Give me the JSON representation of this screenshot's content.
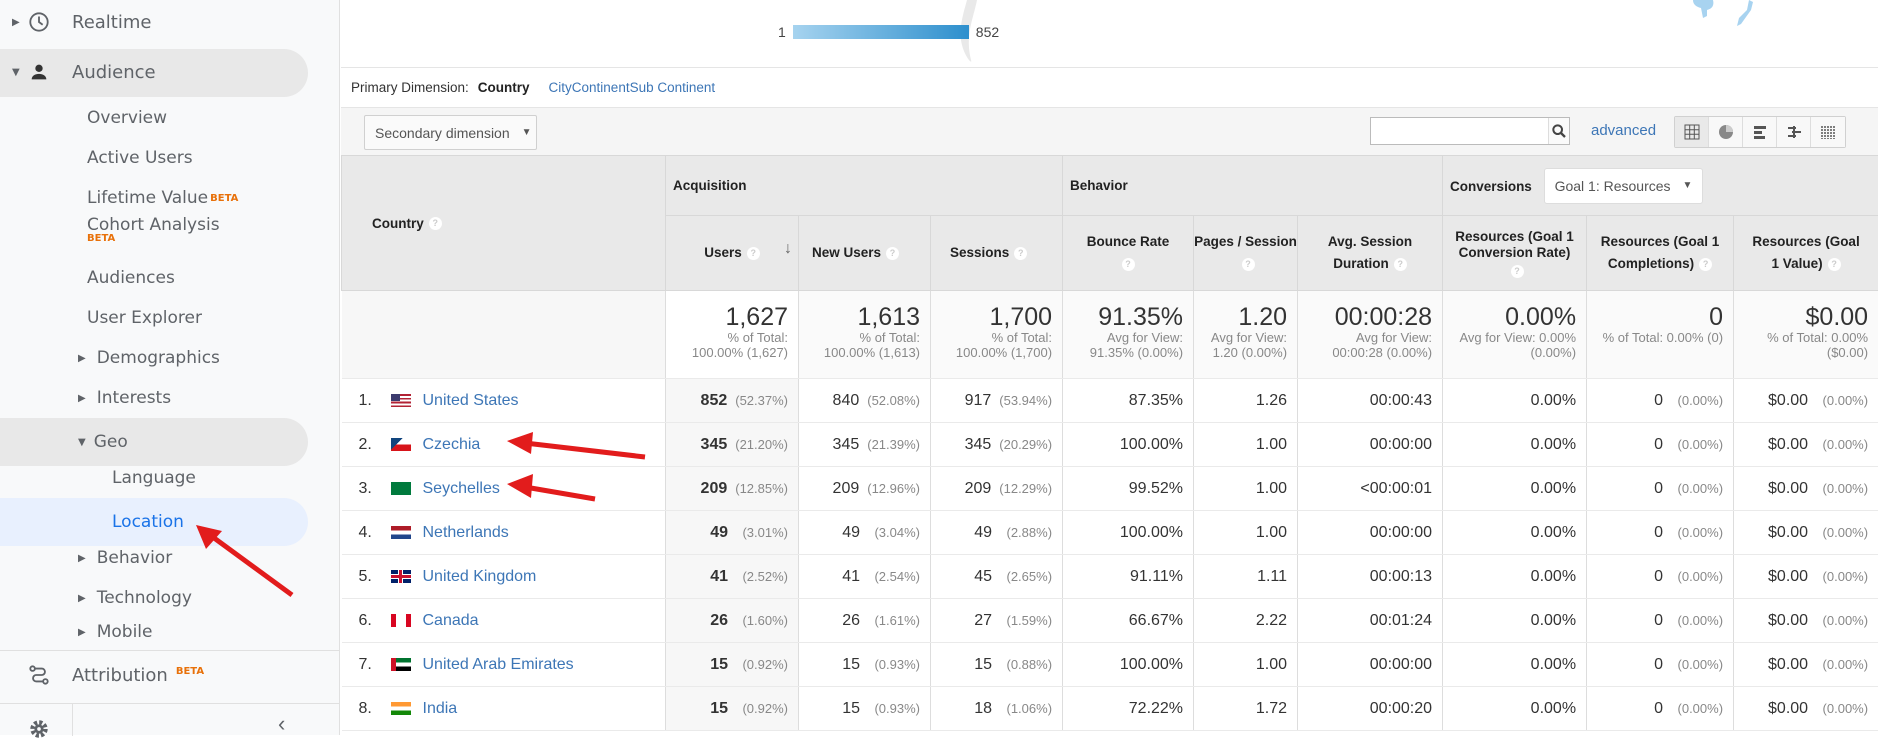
{
  "sidebar": {
    "items": [
      {
        "label": "Realtime",
        "icon": "clock-icon"
      },
      {
        "label": "Audience",
        "icon": "person-icon"
      },
      {
        "label": "Overview"
      },
      {
        "label": "Active Users"
      },
      {
        "label": "Lifetime Value",
        "badge": "BETA"
      },
      {
        "label": "Cohort Analysis",
        "badge": "BETA"
      },
      {
        "label": "Audiences"
      },
      {
        "label": "User Explorer"
      },
      {
        "label": "Demographics"
      },
      {
        "label": "Interests"
      },
      {
        "label": "Geo"
      },
      {
        "label": "Language"
      },
      {
        "label": "Location"
      },
      {
        "label": "Behavior"
      },
      {
        "label": "Technology"
      },
      {
        "label": "Mobile"
      }
    ],
    "attribution": {
      "label": "Attribution",
      "badge": "BETA",
      "icon": "attribution-icon"
    },
    "settings_icon": "gear-icon",
    "collapse_icon": "chevron-left-icon"
  },
  "map_legend": {
    "min": "1",
    "max": "852"
  },
  "primary_dimension": {
    "label": "Primary Dimension:",
    "current": "Country",
    "options": [
      "City",
      "Continent",
      "Sub Continent"
    ]
  },
  "toolbar": {
    "secondary_dimension": "Secondary dimension",
    "search_value": "",
    "advanced": "advanced",
    "view_icons": [
      "table-view-icon",
      "pie-view-icon",
      "performance-view-icon",
      "comparison-view-icon",
      "pivot-view-icon"
    ]
  },
  "table": {
    "country_header": "Country",
    "groups": {
      "acquisition": "Acquisition",
      "behavior": "Behavior",
      "conversions": "Conversions",
      "goal_select": "Goal 1: Resources"
    },
    "columns": [
      "Users",
      "New Users",
      "Sessions",
      "Bounce Rate",
      "Pages / Session",
      "Avg. Session Duration",
      "Resources (Goal 1 Conversion Rate)",
      "Resources (Goal 1 Completions)",
      "Resources (Goal 1 Value)"
    ],
    "totals": [
      {
        "value": "1,627",
        "sub1": "% of Total:",
        "sub2": "100.00% (1,627)"
      },
      {
        "value": "1,613",
        "sub1": "% of Total:",
        "sub2": "100.00% (1,613)"
      },
      {
        "value": "1,700",
        "sub1": "% of Total:",
        "sub2": "100.00% (1,700)"
      },
      {
        "value": "91.35%",
        "sub1": "Avg for View:",
        "sub2": "91.35% (0.00%)"
      },
      {
        "value": "1.20",
        "sub1": "Avg for View:",
        "sub2": "1.20 (0.00%)"
      },
      {
        "value": "00:00:28",
        "sub1": "Avg for View:",
        "sub2": "00:00:28 (0.00%)"
      },
      {
        "value": "0.00%",
        "sub1": "Avg for View: 0.00%",
        "sub2": "(0.00%)"
      },
      {
        "value": "0",
        "sub1": "% of Total: 0.00% (0)",
        "sub2": ""
      },
      {
        "value": "$0.00",
        "sub1": "% of Total: 0.00%",
        "sub2": "($0.00)"
      }
    ],
    "rows": [
      {
        "rank": "1.",
        "country": "United States",
        "flag": "us",
        "users": "852",
        "users_pct": "(52.37%)",
        "new_users": "840",
        "new_users_pct": "(52.08%)",
        "sessions": "917",
        "sessions_pct": "(53.94%)",
        "bounce": "87.35%",
        "pages": "1.26",
        "duration": "00:00:43",
        "conv_rate": "0.00%",
        "completions": "0",
        "completions_pct": "(0.00%)",
        "value": "$0.00",
        "value_pct": "(0.00%)"
      },
      {
        "rank": "2.",
        "country": "Czechia",
        "flag": "cz",
        "users": "345",
        "users_pct": "(21.20%)",
        "new_users": "345",
        "new_users_pct": "(21.39%)",
        "sessions": "345",
        "sessions_pct": "(20.29%)",
        "bounce": "100.00%",
        "pages": "1.00",
        "duration": "00:00:00",
        "conv_rate": "0.00%",
        "completions": "0",
        "completions_pct": "(0.00%)",
        "value": "$0.00",
        "value_pct": "(0.00%)"
      },
      {
        "rank": "3.",
        "country": "Seychelles",
        "flag": "sc",
        "users": "209",
        "users_pct": "(12.85%)",
        "new_users": "209",
        "new_users_pct": "(12.96%)",
        "sessions": "209",
        "sessions_pct": "(12.29%)",
        "bounce": "99.52%",
        "pages": "1.00",
        "duration": "<00:00:01",
        "conv_rate": "0.00%",
        "completions": "0",
        "completions_pct": "(0.00%)",
        "value": "$0.00",
        "value_pct": "(0.00%)"
      },
      {
        "rank": "4.",
        "country": "Netherlands",
        "flag": "nl",
        "users": "49",
        "users_pct": "(3.01%)",
        "new_users": "49",
        "new_users_pct": "(3.04%)",
        "sessions": "49",
        "sessions_pct": "(2.88%)",
        "bounce": "100.00%",
        "pages": "1.00",
        "duration": "00:00:00",
        "conv_rate": "0.00%",
        "completions": "0",
        "completions_pct": "(0.00%)",
        "value": "$0.00",
        "value_pct": "(0.00%)"
      },
      {
        "rank": "5.",
        "country": "United Kingdom",
        "flag": "gb",
        "users": "41",
        "users_pct": "(2.52%)",
        "new_users": "41",
        "new_users_pct": "(2.54%)",
        "sessions": "45",
        "sessions_pct": "(2.65%)",
        "bounce": "91.11%",
        "pages": "1.11",
        "duration": "00:00:13",
        "conv_rate": "0.00%",
        "completions": "0",
        "completions_pct": "(0.00%)",
        "value": "$0.00",
        "value_pct": "(0.00%)"
      },
      {
        "rank": "6.",
        "country": "Canada",
        "flag": "ca",
        "users": "26",
        "users_pct": "(1.60%)",
        "new_users": "26",
        "new_users_pct": "(1.61%)",
        "sessions": "27",
        "sessions_pct": "(1.59%)",
        "bounce": "66.67%",
        "pages": "2.22",
        "duration": "00:01:24",
        "conv_rate": "0.00%",
        "completions": "0",
        "completions_pct": "(0.00%)",
        "value": "$0.00",
        "value_pct": "(0.00%)"
      },
      {
        "rank": "7.",
        "country": "United Arab Emirates",
        "flag": "ae",
        "users": "15",
        "users_pct": "(0.92%)",
        "new_users": "15",
        "new_users_pct": "(0.93%)",
        "sessions": "15",
        "sessions_pct": "(0.88%)",
        "bounce": "100.00%",
        "pages": "1.00",
        "duration": "00:00:00",
        "conv_rate": "0.00%",
        "completions": "0",
        "completions_pct": "(0.00%)",
        "value": "$0.00",
        "value_pct": "(0.00%)"
      },
      {
        "rank": "8.",
        "country": "India",
        "flag": "in",
        "users": "15",
        "users_pct": "(0.92%)",
        "new_users": "15",
        "new_users_pct": "(0.93%)",
        "sessions": "18",
        "sessions_pct": "(1.06%)",
        "bounce": "72.22%",
        "pages": "1.72",
        "duration": "00:00:20",
        "conv_rate": "0.00%",
        "completions": "0",
        "completions_pct": "(0.00%)",
        "value": "$0.00",
        "value_pct": "(0.00%)"
      }
    ]
  },
  "colors": {
    "link": "#3d76b6",
    "active_nav": "#1a73e8",
    "beta": "#e8710a",
    "annotation_arrow": "#e21c1c"
  }
}
